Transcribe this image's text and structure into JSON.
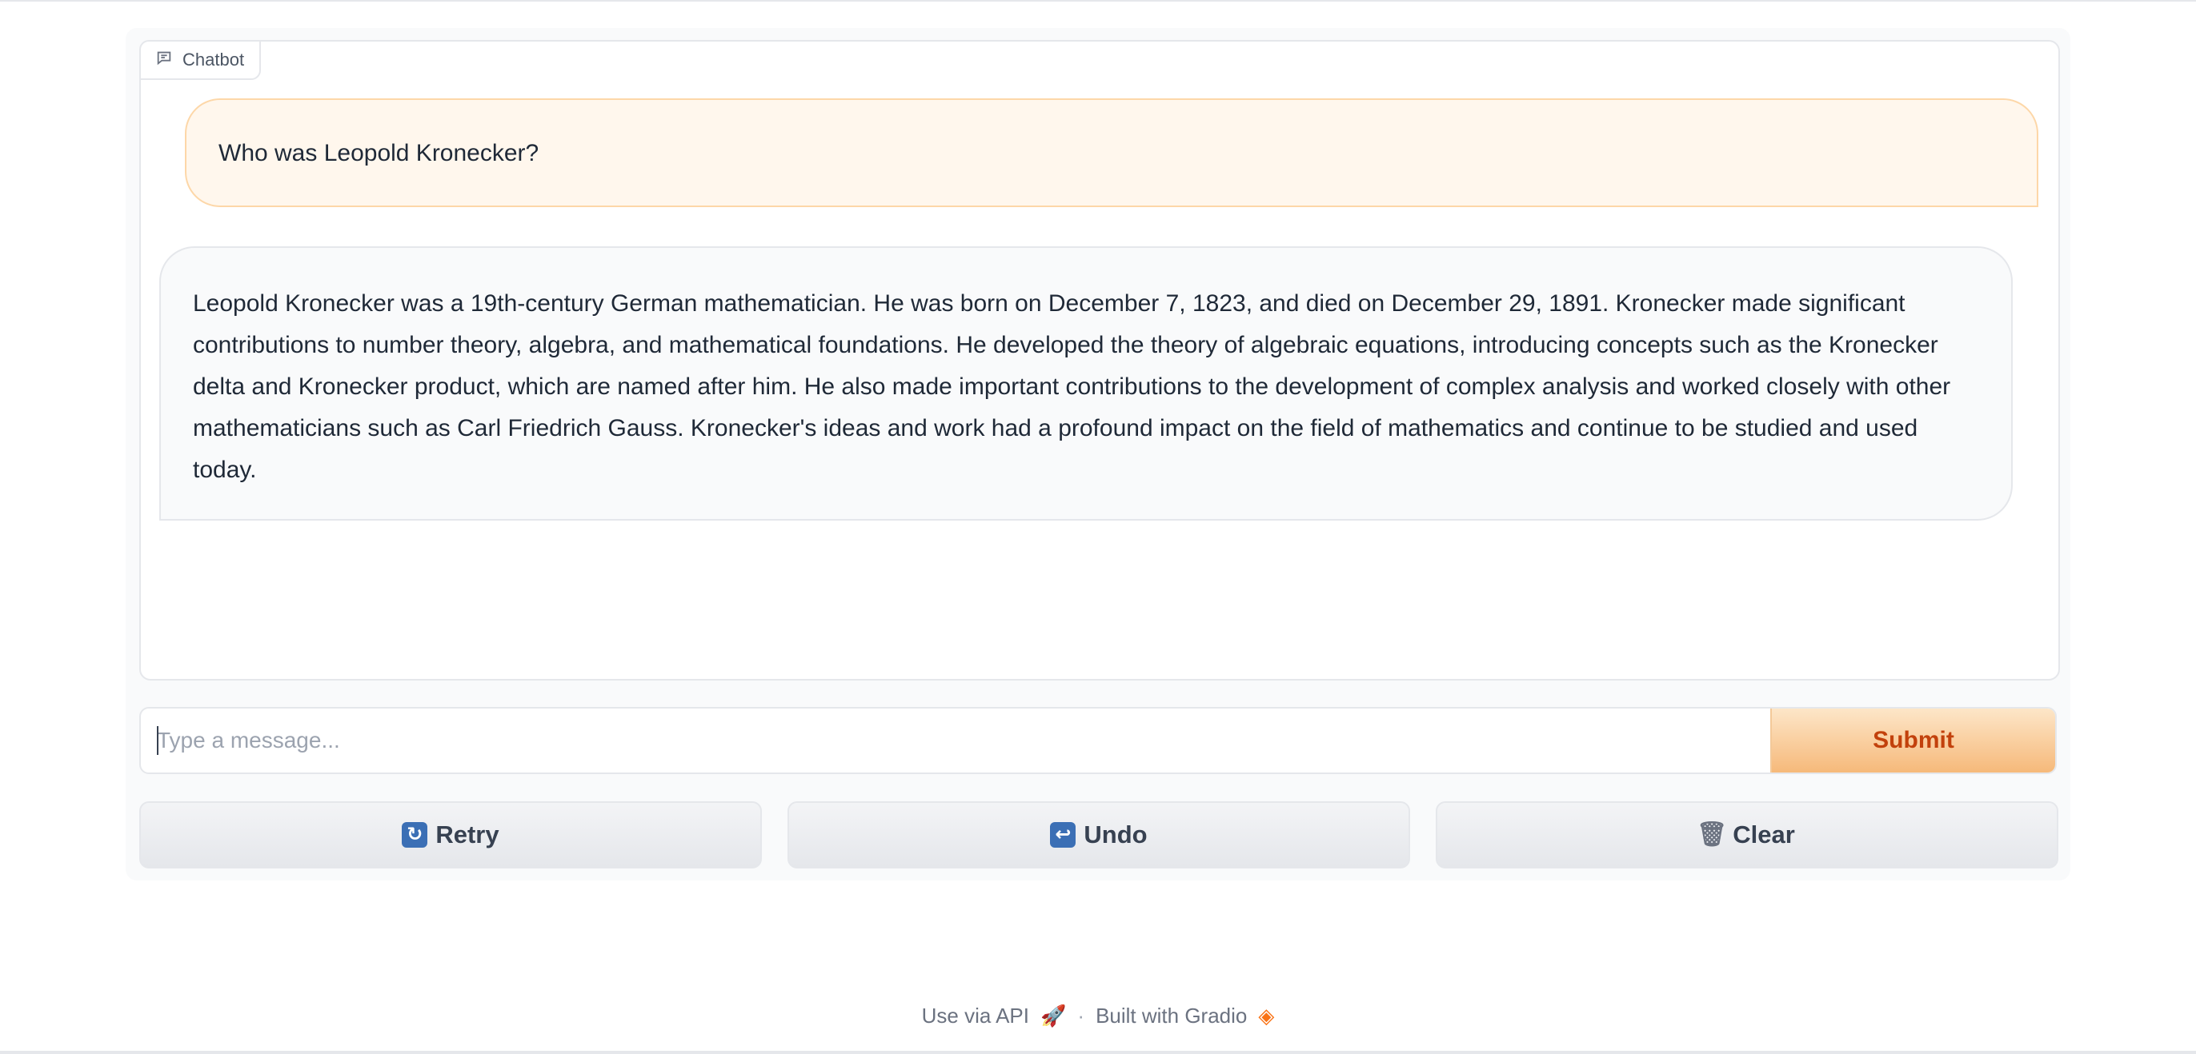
{
  "chatbot": {
    "label": "Chatbot",
    "messages": [
      {
        "role": "user",
        "text": "Who was Leopold Kronecker?"
      },
      {
        "role": "bot",
        "text": "Leopold Kronecker was a 19th-century German mathematician. He was born on December 7, 1823, and died on December 29, 1891. Kronecker made significant contributions to number theory, algebra, and mathematical foundations. He developed the theory of algebraic equations, introducing concepts such as the Kronecker delta and Kronecker product, which are named after him. He also made important contributions to the development of complex analysis and worked closely with other mathematicians such as Carl Friedrich Gauss. Kronecker's ideas and work had a profound impact on the field of mathematics and continue to be studied and used today."
      }
    ]
  },
  "input": {
    "placeholder": "Type a message...",
    "value": ""
  },
  "buttons": {
    "submit": "Submit",
    "retry": "Retry",
    "undo": "Undo",
    "clear": "Clear"
  },
  "icons": {
    "chatbot": "chat-bubble-icon",
    "retry": "retry-icon",
    "undo": "undo-icon",
    "clear": "trash-icon",
    "api": "rocket-icon",
    "gradio": "gradio-logo-icon"
  },
  "footer": {
    "api_link": "Use via API",
    "separator": "·",
    "built_with": "Built with Gradio"
  },
  "colors": {
    "accent": "#f97316",
    "submit_text": "#c2410c",
    "user_bubble": "#fff7ed",
    "bot_bubble": "#f9fafb"
  }
}
